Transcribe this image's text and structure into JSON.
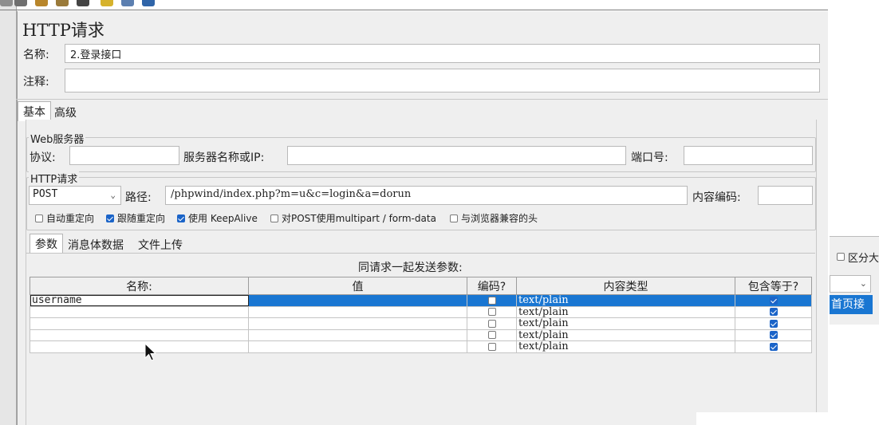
{
  "panel": {
    "title": "HTTP请求",
    "name_label": "名称:",
    "name_value": "2.登录接口",
    "comment_label": "注释:",
    "comment_value": ""
  },
  "tabs": [
    {
      "label": "基本",
      "selected": true
    },
    {
      "label": "高级",
      "selected": false
    }
  ],
  "web_server": {
    "title": "Web服务器",
    "protocol_label": "协议:",
    "protocol_value": "",
    "server_label": "服务器名称或IP:",
    "server_value": "",
    "port_label": "端口号:",
    "port_value": ""
  },
  "http_request": {
    "title": "HTTP请求",
    "method": "POST",
    "path_label": "路径:",
    "path_value": "/phpwind/index.php?m=u&c=login&a=dorun",
    "encoding_label": "内容编码:",
    "encoding_value": ""
  },
  "options": [
    {
      "label": "自动重定向",
      "checked": false
    },
    {
      "label": "跟随重定向",
      "checked": true
    },
    {
      "label": "使用 KeepAlive",
      "checked": true
    },
    {
      "label": "对POST使用multipart / form-data",
      "checked": false
    },
    {
      "label": "与浏览器兼容的头",
      "checked": false
    }
  ],
  "sub_tabs": [
    {
      "label": "参数",
      "selected": true
    },
    {
      "label": "消息体数据",
      "selected": false
    },
    {
      "label": "文件上传",
      "selected": false
    }
  ],
  "params": {
    "caption": "同请求一起发送参数:",
    "headers": [
      "名称:",
      "值",
      "编码?",
      "内容类型",
      "包含等于?"
    ],
    "rows": [
      {
        "name": "username",
        "value": "",
        "encode": false,
        "content_type": "text/plain",
        "include_equals": true
      },
      {
        "name": "",
        "value": "",
        "encode": false,
        "content_type": "text/plain",
        "include_equals": true
      },
      {
        "name": "",
        "value": "",
        "encode": false,
        "content_type": "text/plain",
        "include_equals": true
      },
      {
        "name": "",
        "value": "",
        "encode": false,
        "content_type": "text/plain",
        "include_equals": true
      },
      {
        "name": "",
        "value": "",
        "encode": false,
        "content_type": "text/plain",
        "include_equals": true
      }
    ]
  },
  "side": {
    "checkbox_label": "区分大",
    "selected_item": "首页接"
  },
  "colors": {
    "selection": "#1976d2",
    "checkbox_checked": "#1b64c8",
    "panel_bg": "#efefef"
  }
}
